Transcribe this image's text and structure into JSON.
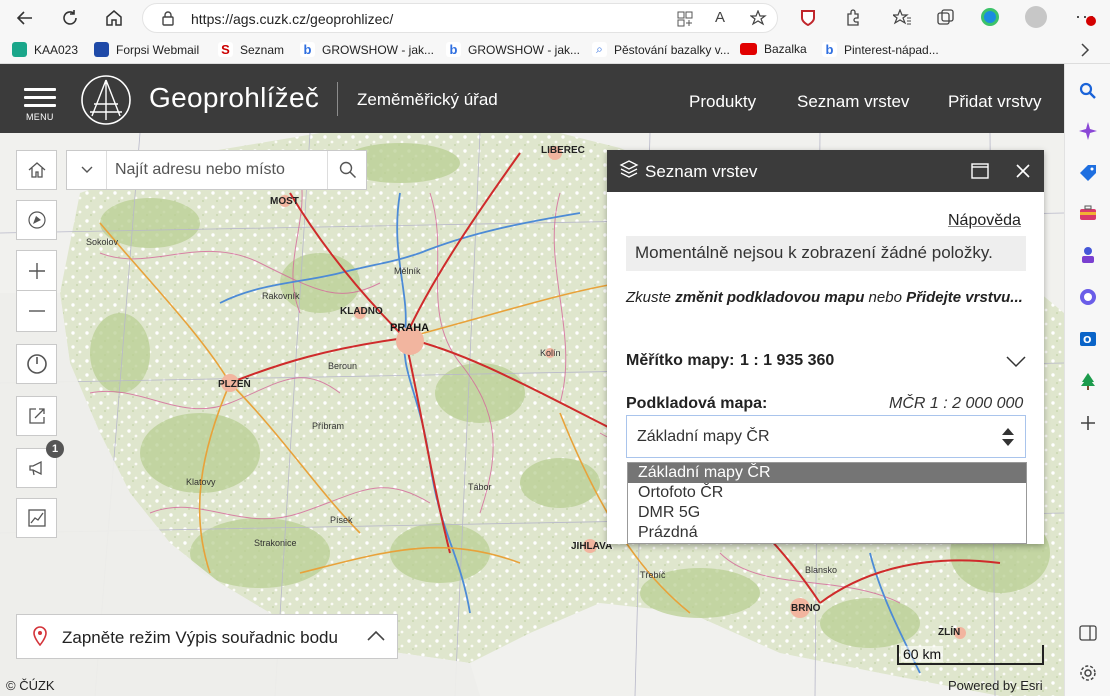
{
  "browser": {
    "url": "https://ags.cuzk.cz/geoprohlizec/",
    "bookmarks": [
      {
        "label": "KAA023",
        "color": "#1aa68a"
      },
      {
        "label": "Forpsi Webmail",
        "color": "#1f4aa8"
      },
      {
        "label": "Seznam",
        "color": "#cc0000"
      },
      {
        "label": "GROWSHOW - jak...",
        "color": "#2f6fe0"
      },
      {
        "label": "GROWSHOW - jak...",
        "color": "#2f6fe0"
      },
      {
        "label": "Pěstování bazalky v...",
        "color": "#2f6fe0"
      },
      {
        "label": "Bazalka",
        "color": "#e10000"
      },
      {
        "label": "Pinterest-nápad...",
        "color": "#2f6fe0"
      }
    ]
  },
  "header": {
    "menu_label": "MENU",
    "title": "Geoprohlížeč",
    "subtitle": "Zeměměřický úřad",
    "nav": [
      "Produkty",
      "Seznam vrstev",
      "Přidat vrstvy"
    ]
  },
  "search": {
    "placeholder": "Najít adresu nebo místo"
  },
  "map": {
    "notification_count": "1",
    "coord_mode_label": "Zapněte režim Výpis souřadnic bodu",
    "copyright": "© ČÚZK",
    "powered_by": "Powered by Esri",
    "scale_bar_label": "60 km",
    "places": [
      {
        "name": "LIBEREC"
      },
      {
        "name": "MOST"
      },
      {
        "name": "KLADNO"
      },
      {
        "name": "PRAHA"
      },
      {
        "name": "PLZEŇ"
      },
      {
        "name": "JIHLAVA"
      },
      {
        "name": "BRNO"
      },
      {
        "name": "ZLÍN"
      },
      {
        "name": "Kolín"
      },
      {
        "name": "Písek"
      },
      {
        "name": "Klatovy"
      },
      {
        "name": "Strakonice"
      },
      {
        "name": "Tábor"
      },
      {
        "name": "Sokolov"
      },
      {
        "name": "Rakovník"
      },
      {
        "name": "Beroun"
      },
      {
        "name": "Mělník"
      },
      {
        "name": "Příbram"
      },
      {
        "name": "Blansko"
      },
      {
        "name": "Třebíč"
      }
    ]
  },
  "layer_panel": {
    "title": "Seznam vrstev",
    "help": "Nápověda",
    "empty_message": "Momentálně nejsou k zobrazení žádné položky.",
    "hint_prefix": "Zkuste ",
    "hint_link1": "změnit podkladovou mapu",
    "hint_mid": " nebo ",
    "hint_link2": "Přidejte vrstvu...",
    "map_scale_label": "Měřítko mapy:",
    "map_scale_value": "1 : 1 935 360",
    "basemap_label": "Podkladová mapa:",
    "basemap_scale": "MČR 1 : 2 000 000",
    "basemap_selected": "Základní mapy ČR",
    "basemap_options": [
      "Základní mapy ČR",
      "Ortofoto ČR",
      "DMR 5G",
      "Prázdná"
    ]
  }
}
